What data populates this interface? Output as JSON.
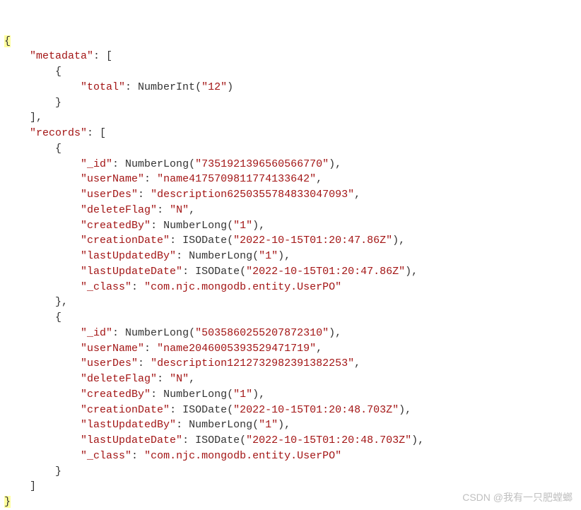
{
  "code": {
    "open_brace": "{",
    "close_brace": "}",
    "metadata_key": "\"metadata\"",
    "colon_arr_open": ": [",
    "obj_open": "{",
    "obj_close": "}",
    "arr_close_comma": "],",
    "arr_close": "]",
    "comma": ",",
    "total_key": "\"total\"",
    "total_call_open": ": NumberInt(",
    "total_arg": "\"12\"",
    "call_close": ")",
    "records_key": "\"records\"",
    "obj_close_comma": "},",
    "r1": {
      "id_key": "\"_id\"",
      "id_call_open": ": NumberLong(",
      "id_arg": "\"7351921396560566770\"",
      "id_close": "),",
      "userName_key": "\"userName\"",
      "userName_sep": ": ",
      "userName_val": "\"name4175709811774133642\"",
      "userDes_key": "\"userDes\"",
      "userDes_val": "\"description6250355784833047093\"",
      "deleteFlag_key": "\"deleteFlag\"",
      "deleteFlag_val": "\"N\"",
      "createdBy_key": "\"createdBy\"",
      "createdBy_call_open": ": NumberLong(",
      "createdBy_arg": "\"1\"",
      "createdBy_close": "),",
      "creationDate_key": "\"creationDate\"",
      "creationDate_call_open": ": ISODate(",
      "creationDate_arg": "\"2022-10-15T01:20:47.86Z\"",
      "creationDate_close": "),",
      "lastUpdatedBy_key": "\"lastUpdatedBy\"",
      "lastUpdatedBy_arg": "\"1\"",
      "lastUpdateDate_key": "\"lastUpdateDate\"",
      "lastUpdateDate_arg": "\"2022-10-15T01:20:47.86Z\"",
      "class_key": "\"_class\"",
      "class_val": "\"com.njc.mongodb.entity.UserPO\""
    },
    "r2": {
      "id_arg": "\"5035860255207872310\"",
      "userName_val": "\"name2046005393529471719\"",
      "userDes_val": "\"description1212732982391382253\"",
      "deleteFlag_val": "\"N\"",
      "createdBy_arg": "\"1\"",
      "creationDate_arg": "\"2022-10-15T01:20:48.703Z\"",
      "lastUpdatedBy_arg": "\"1\"",
      "lastUpdateDate_arg": "\"2022-10-15T01:20:48.703Z\"",
      "class_val": "\"com.njc.mongodb.entity.UserPO\""
    }
  },
  "watermark": "CSDN @我有一只肥螳螂"
}
